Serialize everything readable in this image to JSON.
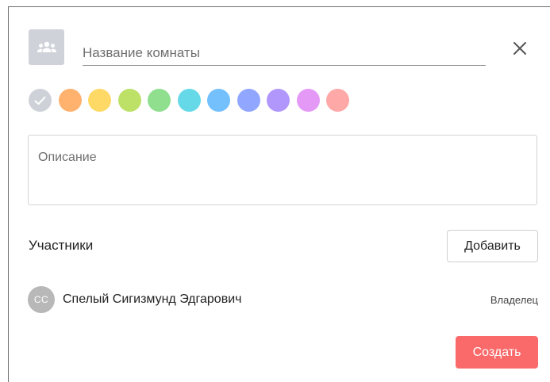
{
  "dialog": {
    "room_name": {
      "value": "",
      "placeholder": "Название комнаты"
    },
    "icons": {
      "room_avatar": "group-icon",
      "close": "close-icon",
      "selected_color": "check-icon"
    },
    "colors": [
      {
        "hex": "#ced2d8",
        "selected": true
      },
      {
        "hex": "#ffb16e",
        "selected": false
      },
      {
        "hex": "#ffd966",
        "selected": false
      },
      {
        "hex": "#bde167",
        "selected": false
      },
      {
        "hex": "#8fdf8f",
        "selected": false
      },
      {
        "hex": "#66d9e8",
        "selected": false
      },
      {
        "hex": "#74c0fc",
        "selected": false
      },
      {
        "hex": "#91a7ff",
        "selected": false
      },
      {
        "hex": "#b197fc",
        "selected": false
      },
      {
        "hex": "#e599f7",
        "selected": false
      },
      {
        "hex": "#ffa8a8",
        "selected": false
      }
    ],
    "description": {
      "value": "",
      "placeholder": "Описание"
    },
    "members": {
      "heading": "Участники",
      "add_label": "Добавить",
      "list": [
        {
          "initials": "СС",
          "name": "Спелый Сигизмунд Эдгарович",
          "role": "Владелец"
        }
      ]
    },
    "create_label": "Создать",
    "accent_color": "#fa6a6a"
  }
}
